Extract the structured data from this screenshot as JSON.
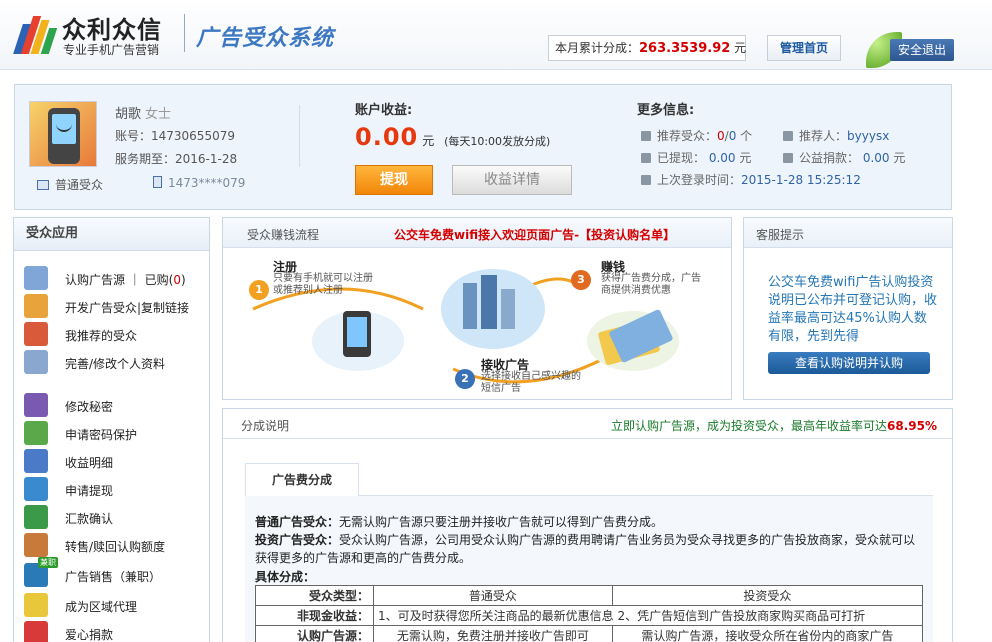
{
  "header": {
    "brand": "众利众信",
    "tagline": "专业手机广告营销",
    "system_title": "广告受众系统",
    "earn_label": "本月累计分成：",
    "earn_amount": "263.3539.92",
    "earn_unit": "元",
    "home_button": "管理首页",
    "logout_button": "安全退出",
    "colors": {
      "accent": "#3d78c2",
      "earn": "#d40000"
    }
  },
  "account": {
    "name": "胡歌",
    "gender": "女士",
    "account_no": "账号：14730655079",
    "expiry": "服务期至：2016-1-28",
    "user_type": "普通受众",
    "phone": "1473****079",
    "income_title": "账户收益:",
    "income_amount": "0.00",
    "income_unit": "元",
    "income_note": "(每天10:00发放分成)",
    "withdraw_button": "提现",
    "detail_button": "收益详情",
    "more_title": "更多信息:",
    "recommend_label": "推荐受众：",
    "recommend_value_a": "0",
    "recommend_value_b": "0",
    "recommend_unit": "个",
    "referrer_label": "推荐人：",
    "referrer_value": "byyysx",
    "withdrawn_label": "已提现：",
    "withdrawn_value": "0.00",
    "withdrawn_unit": "元",
    "charity_label": "公益捐款：",
    "charity_value": "0.00",
    "charity_unit": "元",
    "last_login_label": "上次登录时间：",
    "last_login_value": "2015-1-28 15:25:12"
  },
  "sidebar": {
    "title": "受众应用",
    "items": [
      {
        "label": "认购广告源 ｜ 已购(",
        "count": "0",
        "suffix": ")",
        "icon": "barcode-icon",
        "color": "#7fa6d6"
      },
      {
        "label": "开发广告受众|复制链接",
        "icon": "users-icon",
        "color": "#e8a33a"
      },
      {
        "label": "我推荐的受众",
        "icon": "group-icon",
        "color": "#d85a3a"
      },
      {
        "label": "完善/修改个人资料",
        "icon": "pen-icon",
        "color": "#8aa8cf"
      },
      {
        "label": "修改秘密",
        "icon": "lock-icon",
        "color": "#7a5ab0"
      },
      {
        "label": "申请密码保护",
        "icon": "shield-icon",
        "color": "#5aa84a"
      },
      {
        "label": "收益明细",
        "icon": "bar-chart-icon",
        "color": "#4a7ac8"
      },
      {
        "label": "申请提现",
        "icon": "card-icon",
        "color": "#3a8ad0"
      },
      {
        "label": "汇款确认",
        "icon": "money-icon",
        "color": "#3a9a4a"
      },
      {
        "label": "转售/赎回认购额度",
        "icon": "box-icon",
        "color": "#c87a3a"
      },
      {
        "label": "广告销售（兼职）",
        "badge": "兼职",
        "icon": "tv-icon",
        "color": "#2a7ab8"
      },
      {
        "label": "成为区域代理",
        "icon": "lamp-icon",
        "color": "#e8c83a"
      },
      {
        "label": "爱心捐款",
        "icon": "heart-icon",
        "color": "#d83a3a"
      }
    ]
  },
  "flow": {
    "title": "受众赚钱流程",
    "notice": "公交车免费wifi接入欢迎页面广告-【投资认购名单】",
    "step1_title": "注册",
    "step1_desc1": "只要有手机就可以注册",
    "step1_desc2": "或推荐别人注册",
    "step2_title": "接收广告",
    "step2_desc1": "选择接收自己感兴趣的",
    "step2_desc2": "短信广告",
    "step3_title": "赚钱",
    "step3_desc1": "获得广告费分成，广告",
    "step3_desc2": "商提供消费优惠",
    "n1": "1",
    "n2": "2",
    "n3": "3"
  },
  "service": {
    "title": "客服提示",
    "text": "公交车免费wifi广告认购投资说明已公布并可登记认购，收益率最高可达45%认购人数有限，先到先得",
    "button": "查看认购说明并认购"
  },
  "share": {
    "title": "分成说明",
    "link_text": "立即认购广告源，成为投资受众，最高年收益率可达",
    "link_rate": "68.95%",
    "tab": "广告费分成",
    "normal_label": "普通广告受众：",
    "normal_text": "无需认购广告源只要注册并接收广告就可以得到广告费分成。",
    "invest_label": "投资广告受众：",
    "invest_text1": "受众认购广告源，公司用受众认购广告源的费用聘请广告业务员为受众寻找更多的广告投放商家，受众就可以",
    "invest_text2": "获得更多的广告源和更高的广告费分成。",
    "detail_title": "具体分成：",
    "table": {
      "head": [
        "受众类型：",
        "普通受众",
        "投资受众"
      ],
      "row1_key": "非现金收益：",
      "row1_val": "1、可及时获得您所关注商品的最新优惠信息 2、凭广告短信到广告投放商家购买商品可打折",
      "row2_key": "认购广告源：",
      "row2_a": "无需认购，免费注册并接收广告即可",
      "row2_b": "需认购广告源，接收受众所在省份内的商家广告"
    }
  }
}
